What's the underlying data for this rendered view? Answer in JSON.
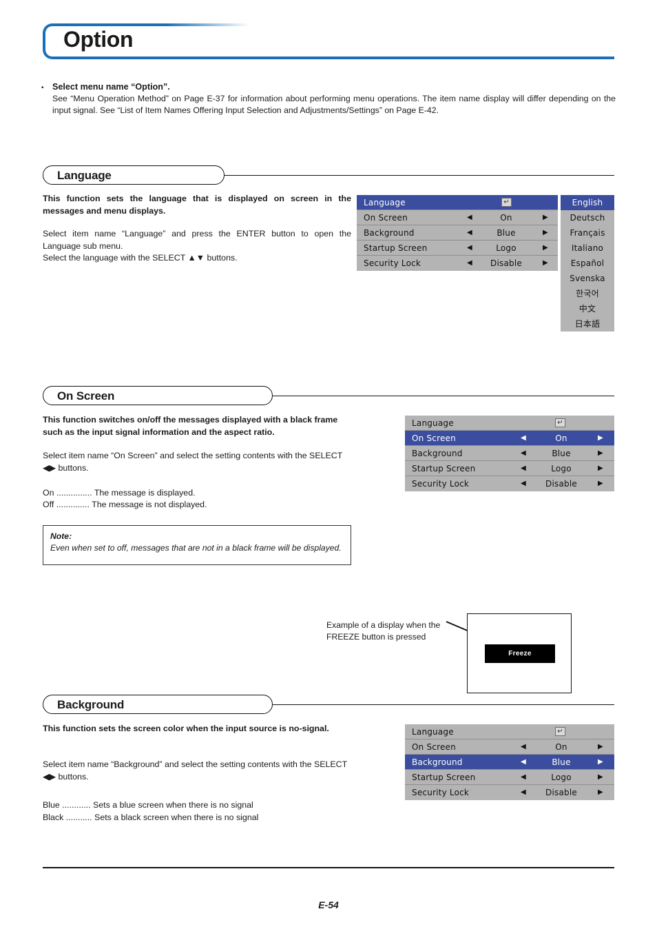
{
  "page": {
    "title": "Option",
    "footer_page_number": "E-54",
    "accent_color": "#1a70b8",
    "osd_highlight_color": "#3b4d9e",
    "osd_background_color": "#b4b4b4"
  },
  "intro": {
    "bullet": "•",
    "heading": "Select menu name “Option”.",
    "body": "See “Menu Operation Method” on Page E-37 for information about performing menu operations. The item name display will differ depending on the input signal. See “List of Item Names Offering Input Selection and Adjustments/Settings” on Page E-42."
  },
  "sections": {
    "language": {
      "heading": "Language",
      "paragraph_bold": "This function sets the language that is displayed on screen in the messages and menu displays.",
      "paragraph_1": "Select item name “Language” and press the ENTER button to open the Language sub menu.",
      "paragraph_2": "Select the language with the SELECT ▲▼ buttons."
    },
    "on_screen": {
      "heading": "On Screen",
      "paragraph_bold": "This function switches on/off the messages displayed with a black frame such as the input signal information and the aspect ratio.",
      "paragraph_1": "Select item name “On Screen” and select the setting contents with the SELECT ◀▶ buttons.",
      "option_on": "On ............... The message is displayed.",
      "option_off": "Off .............. The message is not displayed.",
      "note_label": "Note:",
      "note_text": "Even when set to off, messages that are not in a black frame will be displayed."
    },
    "background": {
      "heading": "Background",
      "paragraph_bold": "This function sets the screen color when the input source is no-signal.",
      "paragraph_1": "Select item name “Background” and select the setting contents with the SELECT ◀▶ buttons.",
      "option_blue": "Blue ............ Sets a blue screen when there is no signal",
      "option_black": "Black ........... Sets a black screen when there is no signal"
    }
  },
  "osd_language_menu": {
    "enter_icon": "↵",
    "rows": [
      {
        "label": "Language",
        "value": "",
        "has_arrows": false,
        "has_enter_icon": true,
        "highlighted": true
      },
      {
        "label": "On Screen",
        "value": "On",
        "has_arrows": true,
        "has_enter_icon": false,
        "highlighted": false
      },
      {
        "label": "Background",
        "value": "Blue",
        "has_arrows": true,
        "has_enter_icon": false,
        "highlighted": false
      },
      {
        "label": "Startup Screen",
        "value": "Logo",
        "has_arrows": true,
        "has_enter_icon": false,
        "highlighted": false
      },
      {
        "label": "Security Lock",
        "value": "Disable",
        "has_arrows": true,
        "has_enter_icon": false,
        "highlighted": false
      }
    ],
    "language_options": [
      {
        "label": "English",
        "highlighted": true
      },
      {
        "label": "Deutsch",
        "highlighted": false
      },
      {
        "label": "Français",
        "highlighted": false
      },
      {
        "label": "Italiano",
        "highlighted": false
      },
      {
        "label": "Español",
        "highlighted": false
      },
      {
        "label": "Svenska",
        "highlighted": false
      },
      {
        "label": "한국어",
        "highlighted": false
      },
      {
        "label": "中文",
        "highlighted": false
      },
      {
        "label": "日本語",
        "highlighted": false
      }
    ]
  },
  "osd_on_screen_menu": {
    "enter_icon": "↵",
    "rows": [
      {
        "label": "Language",
        "value": "",
        "has_arrows": false,
        "has_enter_icon": true,
        "highlighted": false
      },
      {
        "label": "On Screen",
        "value": "On",
        "has_arrows": true,
        "has_enter_icon": false,
        "highlighted": true
      },
      {
        "label": "Background",
        "value": "Blue",
        "has_arrows": true,
        "has_enter_icon": false,
        "highlighted": false
      },
      {
        "label": "Startup Screen",
        "value": "Logo",
        "has_arrows": true,
        "has_enter_icon": false,
        "highlighted": false
      },
      {
        "label": "Security Lock",
        "value": "Disable",
        "has_arrows": true,
        "has_enter_icon": false,
        "highlighted": false
      }
    ]
  },
  "osd_background_menu": {
    "enter_icon": "↵",
    "rows": [
      {
        "label": "Language",
        "value": "",
        "has_arrows": false,
        "has_enter_icon": true,
        "highlighted": false
      },
      {
        "label": "On Screen",
        "value": "On",
        "has_arrows": true,
        "has_enter_icon": false,
        "highlighted": false
      },
      {
        "label": "Background",
        "value": "Blue",
        "has_arrows": true,
        "has_enter_icon": false,
        "highlighted": true
      },
      {
        "label": "Startup Screen",
        "value": "Logo",
        "has_arrows": true,
        "has_enter_icon": false,
        "highlighted": false
      },
      {
        "label": "Security Lock",
        "value": "Disable",
        "has_arrows": true,
        "has_enter_icon": false,
        "highlighted": false
      }
    ]
  },
  "freeze_example": {
    "caption_line_1": "Example of a display when the",
    "caption_line_2": "FREEZE button is pressed",
    "message_label": "Freeze"
  },
  "arrows": {
    "left": "◀",
    "right": "▶"
  }
}
